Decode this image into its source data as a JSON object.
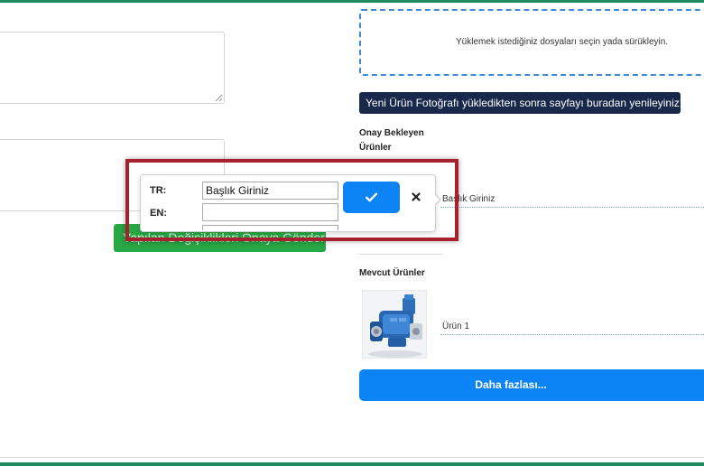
{
  "left_form": {
    "submit_label": "Yapılan Değişiklikleri Onaya Gönder"
  },
  "upload": {
    "hint": "Yüklemek istediğiniz dosyaları seçin yada sürükleyin."
  },
  "refresh_banner": "Yeni Ürün Fotoğrafı yükledikten sonra sayfayı buradan yenileyiniz!",
  "pending": {
    "title": "Onay Bekleyen Ürünler",
    "items": [
      {
        "title": "Başlık Giriniz"
      }
    ]
  },
  "edit_popover": {
    "tr_label": "TR:",
    "en_label": "EN:",
    "tr_value": "Başlık Giriniz",
    "en_value": ""
  },
  "existing": {
    "title": "Mevcut Ürünler",
    "items": [
      {
        "name": "Ürün 1"
      }
    ]
  },
  "more_button_label": "Daha fazlası...",
  "colors": {
    "brand_green": "#1e8a5e",
    "primary_blue": "#0d84f5",
    "banner_navy": "#17284a",
    "submit_green": "#28a745",
    "highlight_red": "#a8202e"
  },
  "icons": {
    "confirm": "check-icon",
    "cancel": "close-icon",
    "resize": "resize-grip-icon"
  }
}
